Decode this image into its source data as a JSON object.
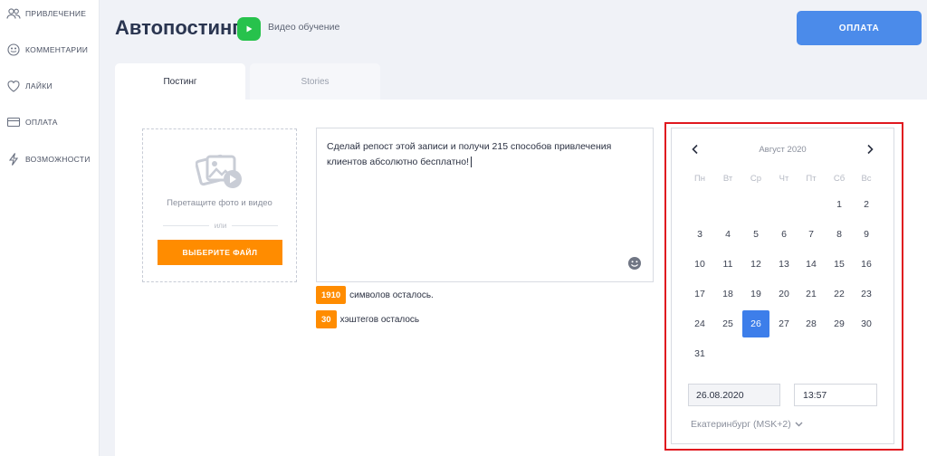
{
  "sidebar": {
    "items": [
      {
        "label": "ПРИВЛЕЧЕНИЕ",
        "icon": "users-icon"
      },
      {
        "label": "КОММЕНТАРИИ",
        "icon": "chat-icon"
      },
      {
        "label": "ЛАЙКИ",
        "icon": "heart-icon"
      },
      {
        "label": "ОПЛАТА",
        "icon": "card-icon"
      },
      {
        "label": "ВОЗМОЖНОСТИ",
        "icon": "lightning-icon"
      }
    ]
  },
  "header": {
    "title": "Автопостинг",
    "video_label": "Видео обучение",
    "pay_label": "ОПЛАТА"
  },
  "tabs": [
    {
      "label": "Постинг",
      "active": true
    },
    {
      "label": "Stories",
      "active": false
    }
  ],
  "upload": {
    "drop_text": "Перетащите фото и видео",
    "or_text": "или",
    "button_label": "ВЫБЕРИТЕ ФАЙЛ"
  },
  "post": {
    "text": "Сделай репост этой записи и получи 215 способов привлечения клиентов абсолютно бесплатно!"
  },
  "counters": {
    "chars_value": "1910",
    "chars_text": "символов осталось.",
    "tags_value": "30",
    "tags_text": "хэштегов осталось"
  },
  "calendar": {
    "month": "Август 2020",
    "weekdays": [
      "Пн",
      "Вт",
      "Ср",
      "Чт",
      "Пт",
      "Сб",
      "Вс"
    ],
    "weeks": [
      [
        "",
        "",
        "",
        "",
        "",
        "1",
        "2"
      ],
      [
        "3",
        "4",
        "5",
        "6",
        "7",
        "8",
        "9"
      ],
      [
        "10",
        "11",
        "12",
        "13",
        "14",
        "15",
        "16"
      ],
      [
        "17",
        "18",
        "19",
        "20",
        "21",
        "22",
        "23"
      ],
      [
        "24",
        "25",
        "26",
        "27",
        "28",
        "29",
        "30"
      ],
      [
        "31",
        "",
        "",
        "",
        "",
        "",
        ""
      ]
    ],
    "selected_day": "26",
    "date_value": "26.08.2020",
    "time_value": "13:57",
    "timezone": "Екатеринбург (MSK+2)"
  },
  "colors": {
    "accent_blue": "#4b8bea",
    "accent_orange": "#ff8c00",
    "video_green": "#27c24c",
    "highlight_red": "#e0181f",
    "selected_day": "#3d7eea"
  }
}
